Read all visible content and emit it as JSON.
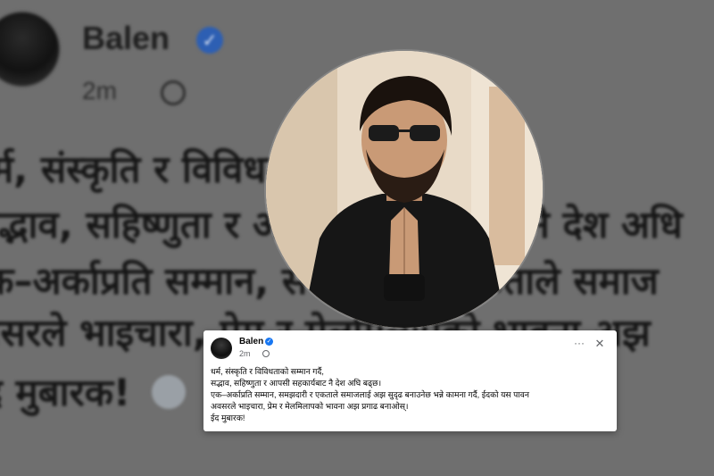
{
  "background_post": {
    "name": "Balen",
    "time": "2m",
    "lines": [
      "र्म, संस्कृति र विविधताको सम्मान गर्दै,",
      "सद्भाव, सहिष्णुता र आपसी सहकार्यबाट नै देश अधि",
      "एक–अर्काप्रति सम्मान, समझदारी र एकताले समाज",
      "अवसरले भाइचारा, प्रेम र मेलमिलापको भावना अझ",
      "ईद मुबारक!"
    ]
  },
  "post": {
    "author": "Balen",
    "time": "2m",
    "more_label": "···",
    "close_label": "✕",
    "lines": [
      "धर्म, संस्कृति र विविधताको सम्मान गर्दै,",
      "सद्भाव, सहिष्णुता र आपसी सहकार्यबाट नै देश अघि बढ्छ।",
      "एक–अर्काप्रति सम्मान, समझदारी र एकताले समाजलाई अझ सुदृढ बनाउनेछ भन्ने कामना गर्दै, ईदको यस पावन",
      "अवसरले भाइचारा, प्रेम र मेलमिलापको भावना अझ प्रगाढ बनाओस्।",
      "ईद मुबारक!"
    ]
  },
  "icons": {
    "verified": "verified-badge-icon",
    "globe": "globe-icon",
    "more": "more-options-icon",
    "close": "close-icon"
  },
  "colors": {
    "verified": "#1877f2",
    "meta_text": "#65676b",
    "card_bg": "#ffffff",
    "background": "#6f6f6f"
  }
}
